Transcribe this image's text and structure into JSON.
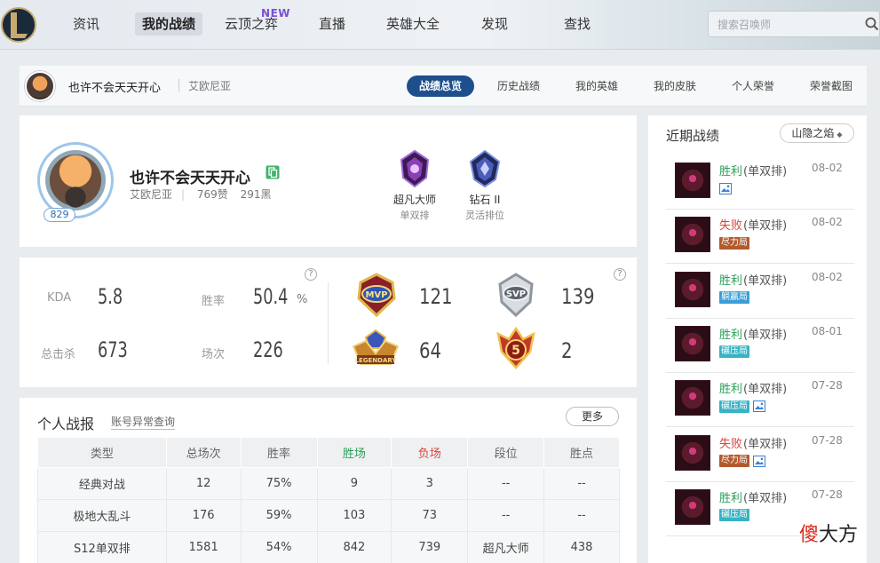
{
  "nav": {
    "items": [
      {
        "label": "资讯"
      },
      {
        "label": "我的战绩"
      },
      {
        "label": "云顶之弈",
        "badge": "NEW"
      },
      {
        "label": "直播"
      },
      {
        "label": "英雄大全"
      },
      {
        "label": "发现"
      },
      {
        "label": "查找"
      }
    ],
    "search_placeholder": "搜索召唤师"
  },
  "profile_bar": {
    "name": "也许不会天天开心",
    "server": "艾欧尼亚",
    "tabs": [
      "战绩总览",
      "历史战绩",
      "我的英雄",
      "我的皮肤",
      "个人荣誉",
      "荣誉截图"
    ]
  },
  "profile": {
    "name": "也许不会天天开心",
    "server": "艾欧尼亚",
    "likes": "769赞",
    "blacks": "291黑",
    "level": "829",
    "ranks": [
      {
        "name": "超凡大师",
        "queue": "单双排",
        "color": "#8a3fb5"
      },
      {
        "name": "钻石 II",
        "queue": "灵活排位",
        "color": "#4b5db8"
      }
    ]
  },
  "stats": {
    "kda_label": "KDA",
    "kda": "5.8",
    "winrate_label": "胜率",
    "winrate": "50.4",
    "winrate_unit": "%",
    "kills_label": "总击杀",
    "kills": "673",
    "games_label": "场次",
    "games": "226",
    "help": "?",
    "medals": [
      {
        "name": "mvp-medal",
        "count": "121"
      },
      {
        "name": "svp-medal",
        "count": "139"
      },
      {
        "name": "legendary-medal",
        "count": "64"
      },
      {
        "name": "penta-kill-medal",
        "count": "2"
      }
    ]
  },
  "history": {
    "title": "个人战报",
    "link": "账号异常查询",
    "more": "更多",
    "headers": [
      "类型",
      "总场次",
      "胜率",
      "胜场",
      "负场",
      "段位",
      "胜点"
    ],
    "rows": [
      [
        "经典对战",
        "12",
        "75%",
        "9",
        "3",
        "--",
        "--"
      ],
      [
        "极地大乱斗",
        "176",
        "59%",
        "103",
        "73",
        "--",
        "--"
      ],
      [
        "S12单双排",
        "1581",
        "54%",
        "842",
        "739",
        "超凡大师",
        "438"
      ]
    ]
  },
  "recent": {
    "title": "近期战绩",
    "mode": "山隐之焰",
    "matches": [
      {
        "result": "胜利",
        "win": true,
        "queue": "(单双排)",
        "date": "08-02",
        "tags": [],
        "pic": true
      },
      {
        "result": "失败",
        "win": false,
        "queue": "(单双排)",
        "date": "08-02",
        "tags": [
          {
            "text": "尽力局",
            "color": "brown"
          }
        ],
        "pic": false
      },
      {
        "result": "胜利",
        "win": true,
        "queue": "(单双排)",
        "date": "08-02",
        "tags": [
          {
            "text": "躺赢局",
            "color": "blue"
          }
        ],
        "pic": false
      },
      {
        "result": "胜利",
        "win": true,
        "queue": "(单双排)",
        "date": "08-01",
        "tags": [
          {
            "text": "碾压局",
            "color": "teal"
          }
        ],
        "pic": false
      },
      {
        "result": "胜利",
        "win": true,
        "queue": "(单双排)",
        "date": "07-28",
        "tags": [
          {
            "text": "碾压局",
            "color": "teal"
          }
        ],
        "pic": true
      },
      {
        "result": "失败",
        "win": false,
        "queue": "(单双排)",
        "date": "07-28",
        "tags": [
          {
            "text": "尽力局",
            "color": "brown"
          }
        ],
        "pic": true
      },
      {
        "result": "胜利",
        "win": true,
        "queue": "(单双排)",
        "date": "07-28",
        "tags": [
          {
            "text": "碾压局",
            "color": "teal"
          }
        ],
        "pic": false
      }
    ]
  },
  "watermark": {
    "red": "傻",
    "black": "大方"
  }
}
